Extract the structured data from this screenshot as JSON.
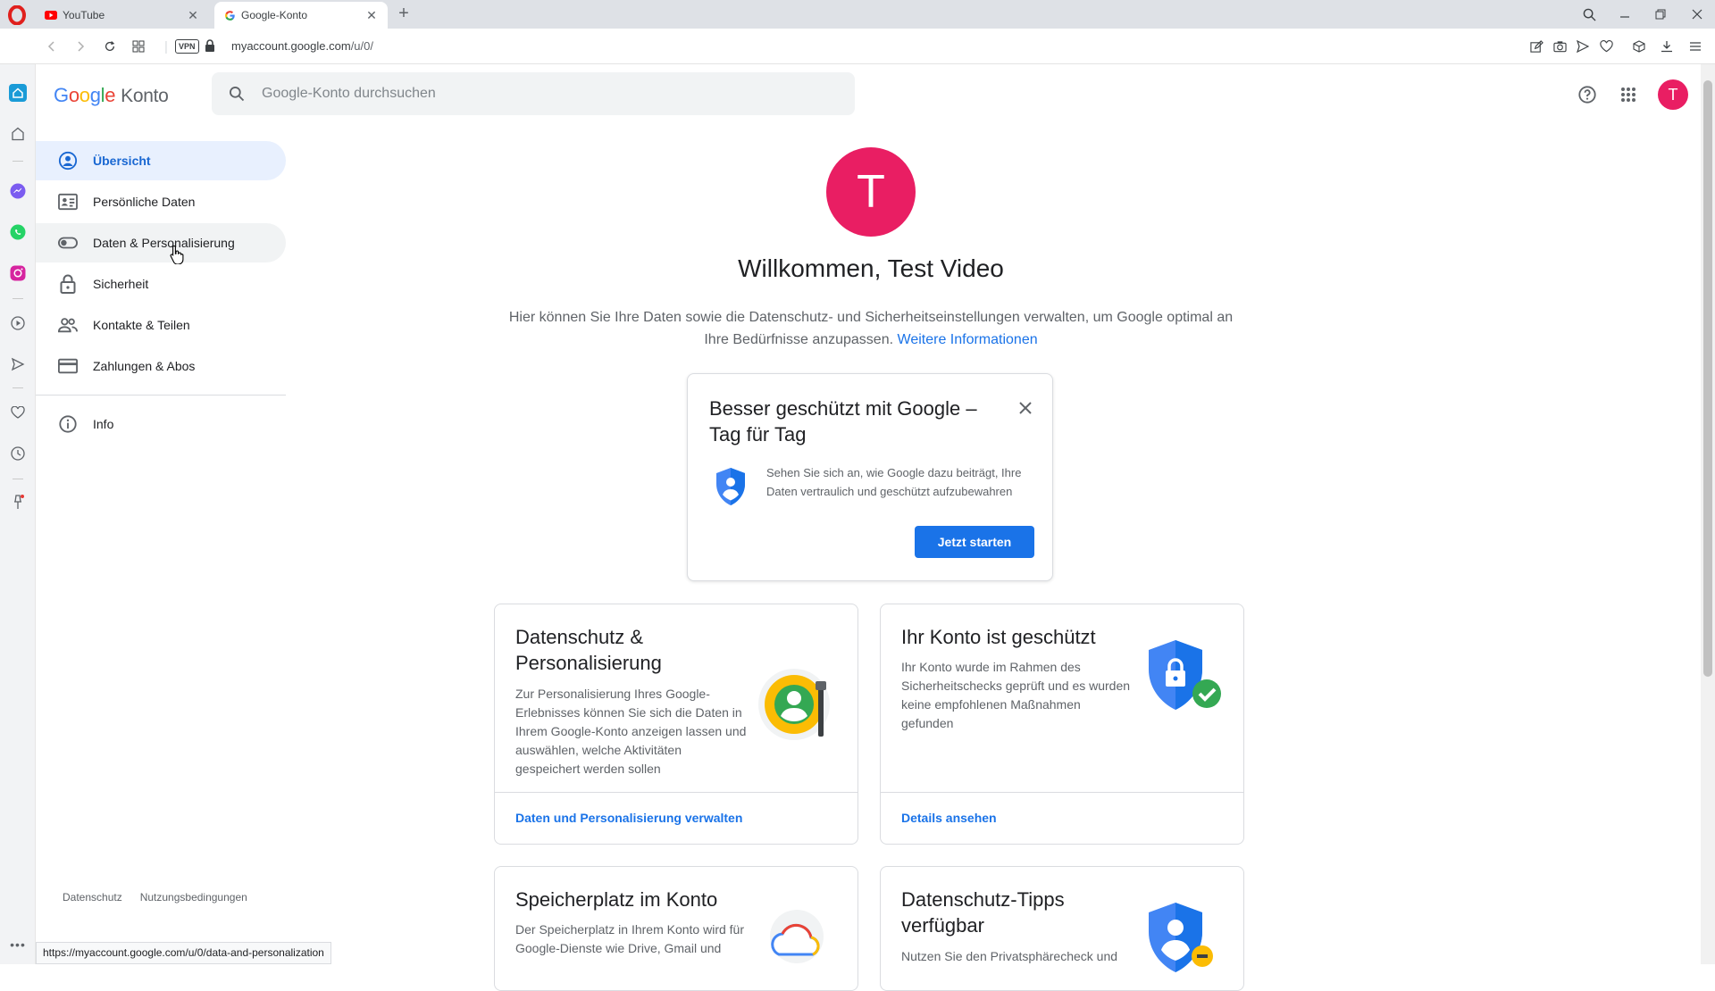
{
  "browser": {
    "tabs": [
      {
        "title": "YouTube",
        "active": false
      },
      {
        "title": "Google-Konto",
        "active": true
      }
    ],
    "url_host": "myaccount.google.com",
    "url_path": "/u/0/",
    "vpn_label": "VPN",
    "status_url": "https://myaccount.google.com/u/0/data-and-personalization"
  },
  "header": {
    "logo_letters": [
      "G",
      "o",
      "o",
      "g",
      "l",
      "e"
    ],
    "product": "Konto",
    "search_placeholder": "Google-Konto durchsuchen",
    "avatar_letter": "T"
  },
  "nav": {
    "items": [
      {
        "label": "Übersicht",
        "icon": "account-circle-icon"
      },
      {
        "label": "Persönliche Daten",
        "icon": "id-card-icon"
      },
      {
        "label": "Daten & Personalisierung",
        "icon": "toggle-icon"
      },
      {
        "label": "Sicherheit",
        "icon": "lock-icon"
      },
      {
        "label": "Kontakte & Teilen",
        "icon": "people-icon"
      },
      {
        "label": "Zahlungen & Abos",
        "icon": "credit-card-icon"
      }
    ],
    "info_label": "Info",
    "footer": {
      "privacy": "Datenschutz",
      "terms": "Nutzungsbedingungen"
    }
  },
  "main": {
    "avatar_letter": "T",
    "welcome": "Willkommen, Test Video",
    "intro": "Hier können Sie Ihre Daten sowie die Datenschutz- und Sicherheitseinstellungen verwalten, um Google optimal an Ihre Bedürfnisse anzupassen.",
    "intro_link": "Weitere Informationen",
    "promo": {
      "title": "Besser geschützt mit Google – Tag für Tag",
      "text": "Sehen Sie sich an, wie Google dazu beiträgt, Ihre Daten vertraulich und geschützt aufzubewahren",
      "button": "Jetzt starten"
    },
    "cards": [
      {
        "title": "Datenschutz & Personalisierung",
        "body": "Zur Personalisierung Ihres Google-Erlebnisses können Sie sich die Daten in Ihrem Google-Konto anzeigen lassen und auswählen, welche Aktivitäten gespeichert werden sollen",
        "link": "Daten und Personalisierung verwalten"
      },
      {
        "title": "Ihr Konto ist geschützt",
        "body": "Ihr Konto wurde im Rahmen des Sicherheitschecks geprüft und es wurden keine empfohlenen Maßnahmen gefunden",
        "link": "Details ansehen"
      },
      {
        "title": "Speicherplatz im Konto",
        "body": "Der Speicherplatz in Ihrem Konto wird für Google-Dienste wie Drive, Gmail und"
      },
      {
        "title": "Datenschutz-Tipps verfügbar",
        "body": "Nutzen Sie den Privatsphärecheck und"
      }
    ]
  },
  "colors": {
    "accent": "#1a73e8",
    "avatar": "#e91e63",
    "nav_selected": "#e8f0fe"
  }
}
